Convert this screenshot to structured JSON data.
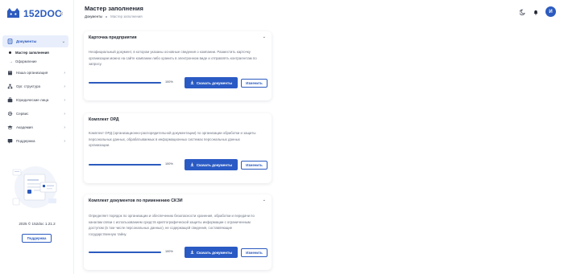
{
  "app": {
    "logo_text": "152DOC"
  },
  "sidebar": {
    "items": [
      {
        "label": "Документы",
        "icon": "document-icon",
        "active": true
      },
      {
        "label": "Наша организация",
        "icon": "building-icon"
      },
      {
        "label": "Орг. структура",
        "icon": "org-structure-icon"
      },
      {
        "label": "Юридические лица",
        "icon": "legal-entity-icon"
      },
      {
        "label": "Сервис",
        "icon": "service-icon"
      },
      {
        "label": "Академия",
        "icon": "academy-icon"
      },
      {
        "label": "Поддержка",
        "icon": "support-icon"
      }
    ],
    "subitems": [
      {
        "label": "Мастер заполнения",
        "active": true
      },
      {
        "label": "Оформление"
      }
    ],
    "version": "2025 © 152doc 1.21.2",
    "support_button": "Поддержка"
  },
  "header": {
    "title": "Мастер заполнения",
    "breadcrumb": [
      "Документы",
      "Мастер заполнения"
    ],
    "avatar_letter": "И"
  },
  "cards": [
    {
      "title": "Карточка предприятия",
      "description": "Неофициальный документ, в котором указаны основные сведения о компании. Разместить карточку организации можно на сайте компании либо хранить в электронном виде и отправлять контрагентам по запросу.",
      "progress": 100,
      "progress_label": "100%",
      "download_label": "Скачать документы",
      "edit_label": "Изменить"
    },
    {
      "title": "Комплект ОРД",
      "description": "Комплект ОРД (организационно-распорядительной документации) по организации обработки и защиты персональных данных, обрабатываемых в информационных системах персональных данных организации.",
      "progress": 100,
      "progress_label": "100%",
      "download_label": "Скачать документы",
      "edit_label": "Изменить"
    },
    {
      "title": "Комплект документов по применению СКЗИ",
      "description": "Определяет порядок по организации и обеспечению безопасности хранения, обработки и передачи по каналам связи с использованием средств криптографической защиты информации с ограниченным доступом (в том числе персональных данных), не содержащей сведения, составляющие государственную тайну.",
      "progress": 100,
      "progress_label": "100%",
      "download_label": "Скачать документы",
      "edit_label": "Изменить"
    }
  ],
  "colors": {
    "accent": "#2c5bbf",
    "active_bg": "#e8eefb"
  }
}
